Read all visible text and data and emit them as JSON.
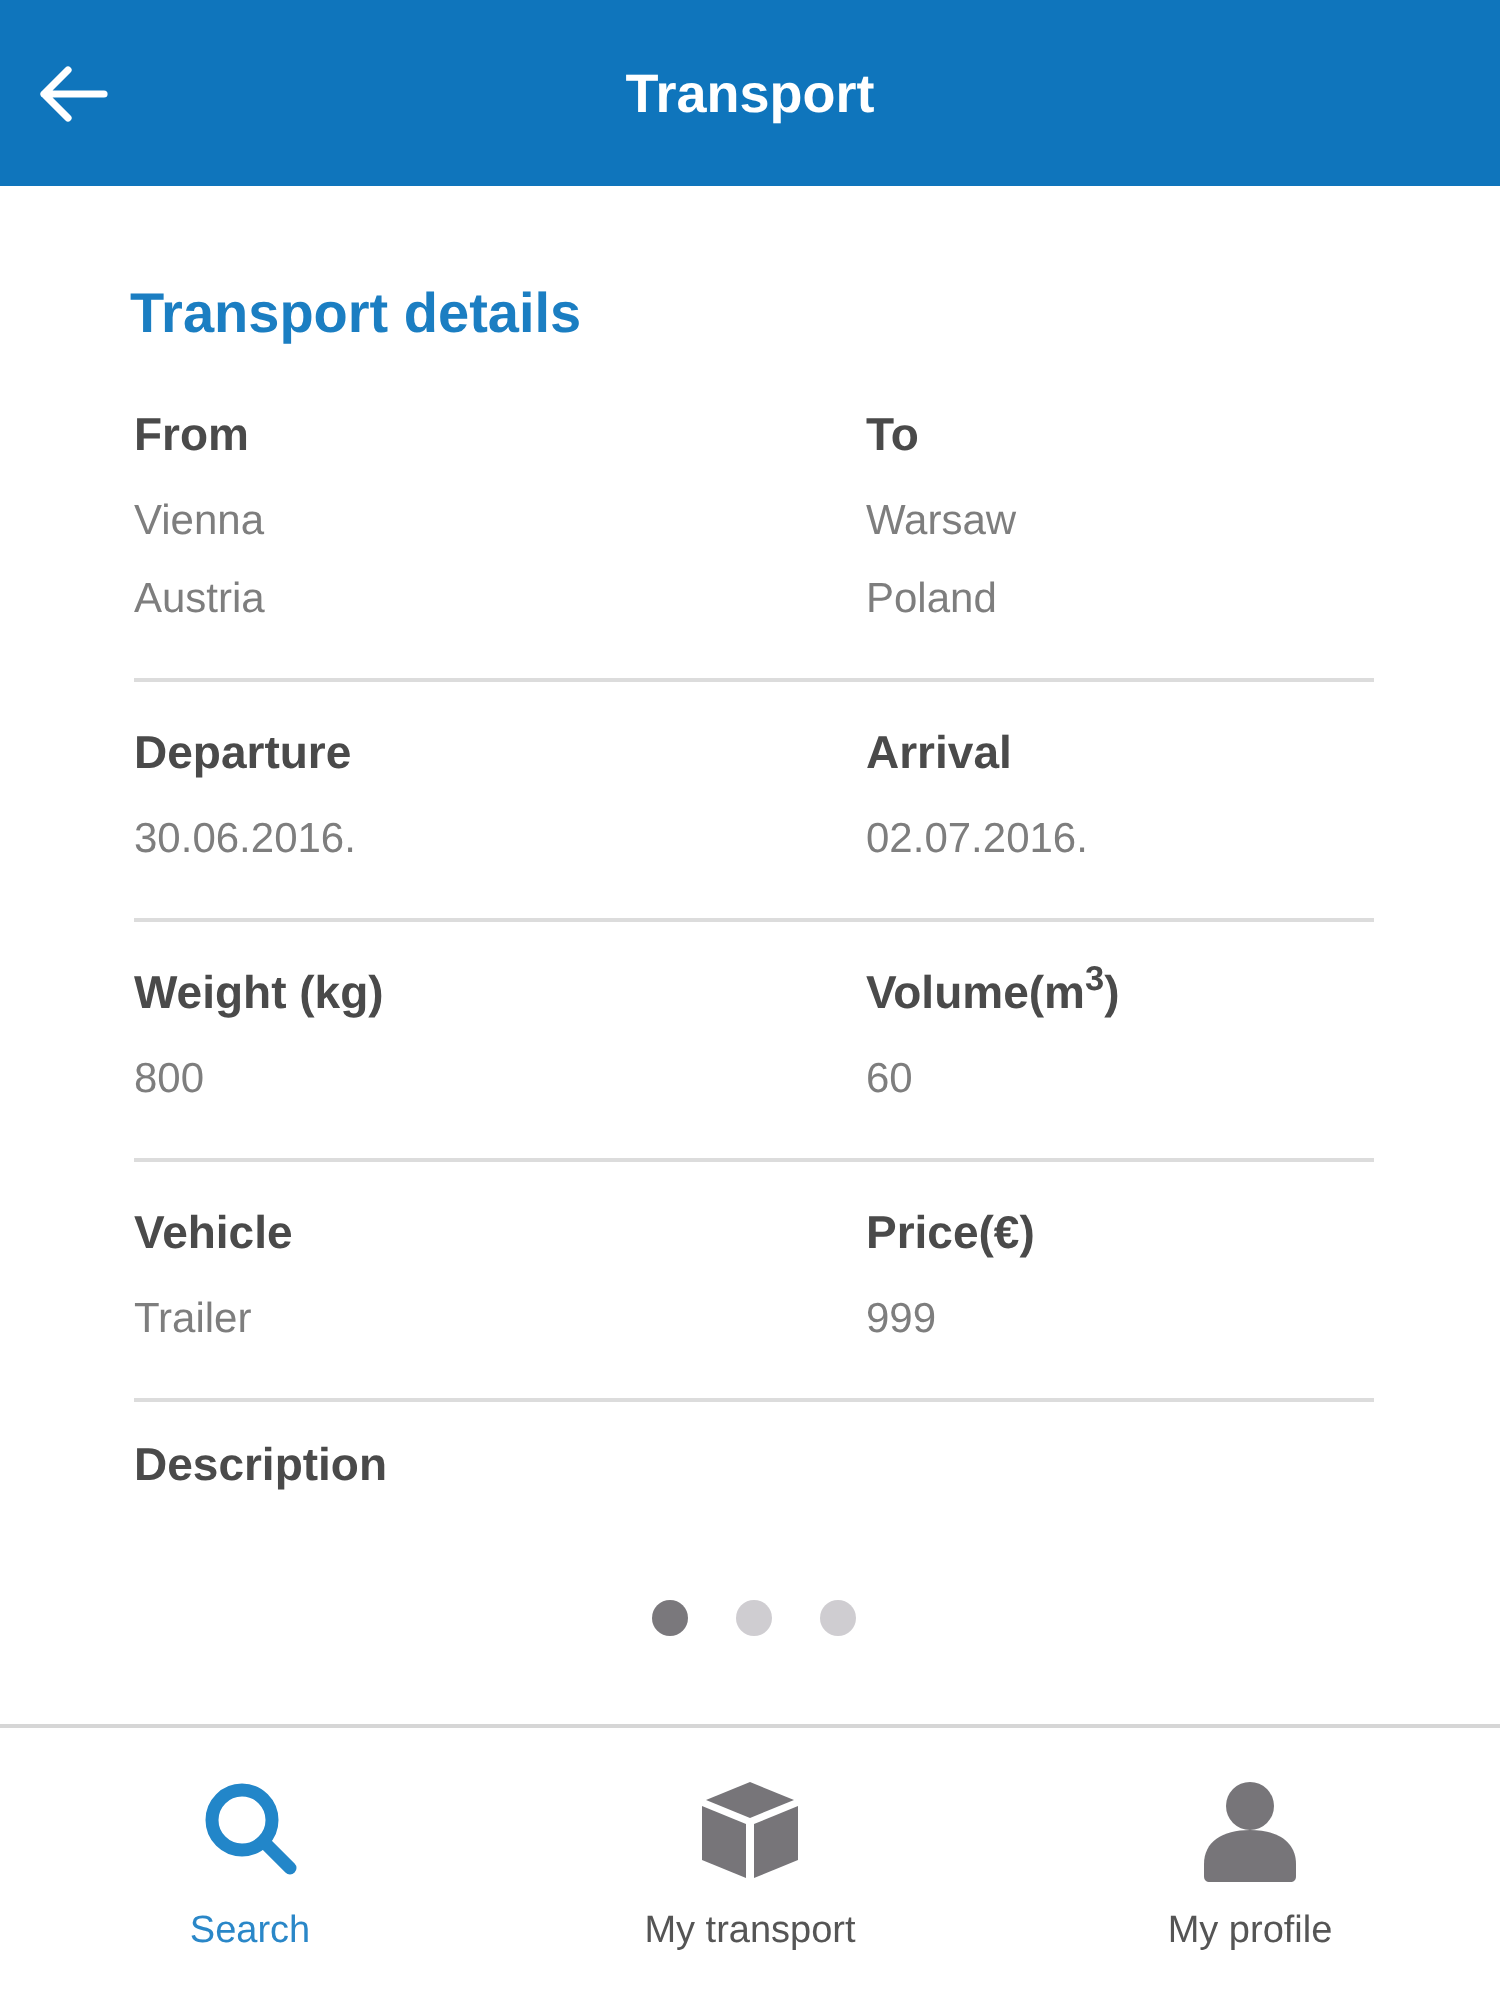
{
  "header": {
    "title": "Transport"
  },
  "section": {
    "title": "Transport details"
  },
  "detail_rows": [
    {
      "fields": [
        {
          "label": "From",
          "values": [
            "Vienna",
            "Austria"
          ]
        },
        {
          "label": "To",
          "values": [
            "Warsaw",
            "Poland"
          ]
        }
      ]
    },
    {
      "fields": [
        {
          "label": "Departure",
          "values": [
            "30.06.2016."
          ]
        },
        {
          "label": "Arrival",
          "values": [
            "02.07.2016."
          ]
        }
      ]
    },
    {
      "fields": [
        {
          "label": "Weight (kg)",
          "values": [
            "800"
          ]
        },
        {
          "label": "Volume(m$^{3}$)",
          "values": [
            "60"
          ]
        }
      ]
    },
    {
      "fields": [
        {
          "label": "Vehicle",
          "values": [
            "Trailer"
          ]
        },
        {
          "label": "Price(€)",
          "values": [
            "999"
          ]
        }
      ]
    },
    {
      "fields": [
        {
          "label": "Description"
        }
      ]
    }
  ],
  "pager": [
    {
      "selected": true
    },
    {
      "selected": false
    },
    {
      "selected": false
    }
  ],
  "tabs": [
    {
      "label": "Search",
      "kind": "search",
      "selected": true
    },
    {
      "label": "My transport",
      "kind": "package",
      "selected": false
    },
    {
      "label": "My profile",
      "kind": "profile",
      "selected": false
    }
  ]
}
